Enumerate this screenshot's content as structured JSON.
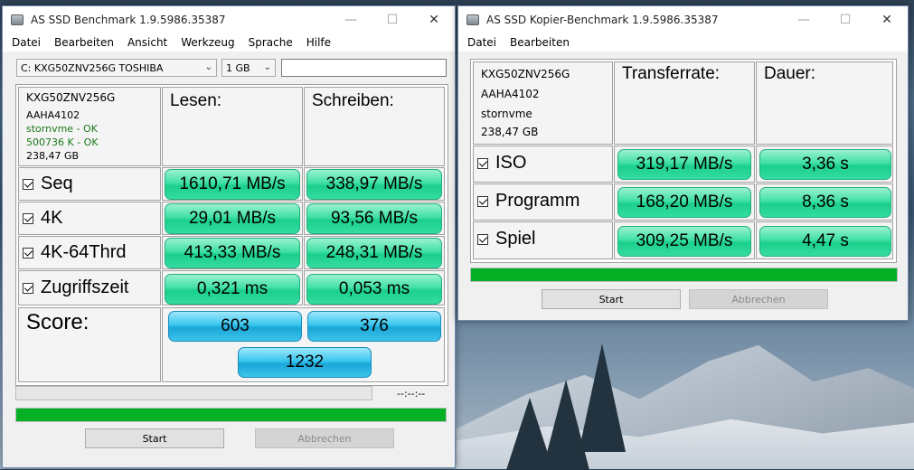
{
  "left_window": {
    "title": "AS SSD Benchmark 1.9.5986.35387",
    "menu": [
      "Datei",
      "Bearbeiten",
      "Ansicht",
      "Werkzeug",
      "Sprache",
      "Hilfe"
    ],
    "drive_select": "C: KXG50ZNV256G TOSHIBA",
    "size_select": "1 GB",
    "drive_info": {
      "model": "KXG50ZNV256G",
      "firmware": "AAHA4102",
      "driver": "stornvme - OK",
      "alignment": "500736 K - OK",
      "capacity": "238,47 GB"
    },
    "headers": {
      "read": "Lesen:",
      "write": "Schreiben:"
    },
    "rows": [
      {
        "label": "Seq",
        "read": "1610,71 MB/s",
        "write": "338,97 MB/s"
      },
      {
        "label": "4K",
        "read": "29,01 MB/s",
        "write": "93,56 MB/s"
      },
      {
        "label": "4K-64Thrd",
        "read": "413,33 MB/s",
        "write": "248,31 MB/s"
      },
      {
        "label": "Zugriffszeit",
        "read": "0,321 ms",
        "write": "0,053 ms"
      }
    ],
    "score": {
      "label": "Score:",
      "read": "603",
      "write": "376",
      "total": "1232"
    },
    "time_text": "--:--:--",
    "progress_top": 0,
    "progress_bottom": 100,
    "start_label": "Start",
    "abort_label": "Abbrechen",
    "colors": {
      "green": "#1bcf8c",
      "blue": "#1aa6d8",
      "progress": "#06b025"
    }
  },
  "right_window": {
    "title": "AS SSD Kopier-Benchmark 1.9.5986.35387",
    "menu": [
      "Datei",
      "Bearbeiten"
    ],
    "drive_info": {
      "model": "KXG50ZNV256G",
      "firmware": "AAHA4102",
      "driver": "stornvme",
      "capacity": "238,47 GB"
    },
    "headers": {
      "rate": "Transferrate:",
      "duration": "Dauer:"
    },
    "rows": [
      {
        "label": "ISO",
        "rate": "319,17 MB/s",
        "duration": "3,36 s"
      },
      {
        "label": "Programm",
        "rate": "168,20 MB/s",
        "duration": "8,36 s"
      },
      {
        "label": "Spiel",
        "rate": "309,25 MB/s",
        "duration": "4,47 s"
      }
    ],
    "progress": 100,
    "start_label": "Start",
    "abort_label": "Abbrechen"
  }
}
